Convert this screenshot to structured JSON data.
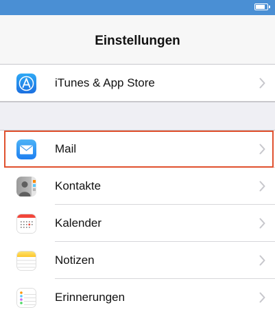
{
  "nav": {
    "title": "Einstellungen"
  },
  "rows": [
    {
      "label": "iTunes & App Store",
      "icon": "app-store-icon"
    },
    {
      "label": "Mail",
      "icon": "mail-icon"
    },
    {
      "label": "Kontakte",
      "icon": "contacts-icon"
    },
    {
      "label": "Kalender",
      "icon": "calendar-icon"
    },
    {
      "label": "Notizen",
      "icon": "notes-icon"
    },
    {
      "label": "Erinnerungen",
      "icon": "reminders-icon"
    }
  ],
  "colors": {
    "status_bar": "#4a8fd4",
    "highlight": "#e0502d",
    "group_background": "#efeff4"
  }
}
